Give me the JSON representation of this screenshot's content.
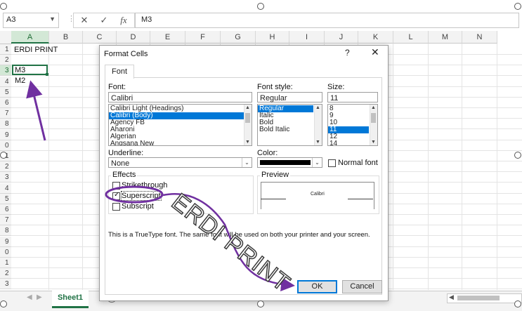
{
  "formula_bar": {
    "name_box": "A3",
    "cancel_glyph": "✕",
    "enter_glyph": "✓",
    "fx_glyph": "fx",
    "value": "M3"
  },
  "columns": [
    "A",
    "B",
    "C",
    "D",
    "E",
    "F",
    "G",
    "H",
    "I",
    "J",
    "K",
    "L",
    "M",
    "N"
  ],
  "rows": [
    "1",
    "2",
    "3",
    "4",
    "5",
    "6",
    "7",
    "8",
    "9",
    "0",
    "1",
    "2",
    "3",
    "4",
    "5",
    "6",
    "7",
    "8",
    "9",
    "0",
    "1",
    "2",
    "3"
  ],
  "cells": {
    "a1": "ERDI PRINT",
    "a3": "M3",
    "a4": "M2"
  },
  "sheet": {
    "tab": "Sheet1",
    "add": "+"
  },
  "dialog": {
    "title": "Format Cells",
    "help": "?",
    "close": "✕",
    "tab": "Font",
    "font_label": "Font:",
    "font_value": "Calibri",
    "font_list": [
      "Calibri Light (Headings)",
      "Calibri (Body)",
      "Agency FB",
      "Aharoni",
      "Algerian",
      "Angsana New"
    ],
    "style_label": "Font style:",
    "style_value": "Regular",
    "style_list": [
      "Regular",
      "Italic",
      "Bold",
      "Bold Italic"
    ],
    "size_label": "Size:",
    "size_value": "11",
    "size_list": [
      "8",
      "9",
      "10",
      "11",
      "12",
      "14"
    ],
    "underline_label": "Underline:",
    "underline_value": "None",
    "color_label": "Color:",
    "normal_font": "Normal font",
    "effects_label": "Effects",
    "strikethrough": "Strikethrough",
    "superscript": "Superscript",
    "subscript": "Subscript",
    "preview_label": "Preview",
    "preview_text": "Calibri",
    "info": "This is a TrueType font.  The same font will be used on both your printer and your screen.",
    "ok": "OK",
    "cancel": "Cancel"
  },
  "watermark": "ERDI PRINT",
  "colors": {
    "accent": "#217346",
    "selection": "#0078d7",
    "annotation": "#7030a0"
  }
}
